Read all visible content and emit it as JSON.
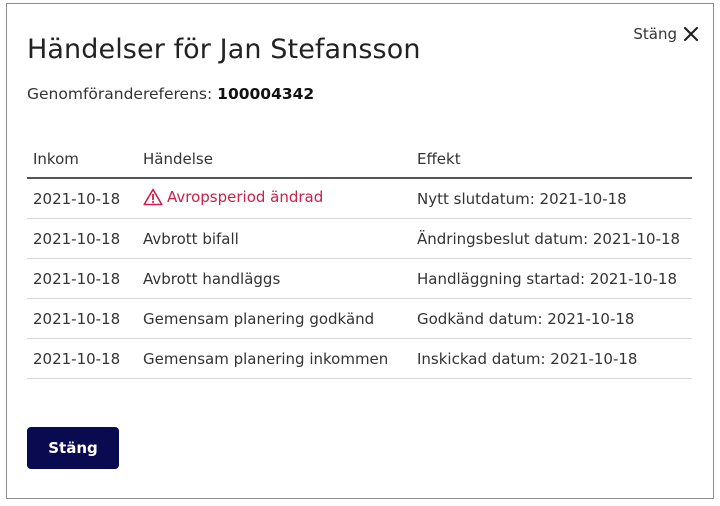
{
  "modal": {
    "close_label": "Stäng",
    "title": "Händelser för Jan Stefansson",
    "reference_label": "Genomförandereferens:",
    "reference_value": "100004342",
    "columns": [
      "Inkom",
      "Händelse",
      "Effekt"
    ],
    "rows": [
      {
        "date": "2021-10-18",
        "event": "Avropsperiod ändrad",
        "effect": "Nytt slutdatum: 2021-10-18",
        "warning": true
      },
      {
        "date": "2021-10-18",
        "event": "Avbrott bifall",
        "effect": "Ändringsbeslut datum: 2021-10-18",
        "warning": false
      },
      {
        "date": "2021-10-18",
        "event": "Avbrott handläggs",
        "effect": "Handläggning startad: 2021-10-18",
        "warning": false
      },
      {
        "date": "2021-10-18",
        "event": "Gemensam planering godkänd",
        "effect": "Godkänd datum: 2021-10-18",
        "warning": false
      },
      {
        "date": "2021-10-18",
        "event": "Gemensam planering inkommen",
        "effect": "Inskickad datum: 2021-10-18",
        "warning": false
      }
    ],
    "button_label": "Stäng"
  },
  "colors": {
    "warning": "#cc1f4a",
    "primary_button": "#0a0a50"
  },
  "icons": {
    "close": "close-icon",
    "warning": "warning-triangle-icon"
  }
}
